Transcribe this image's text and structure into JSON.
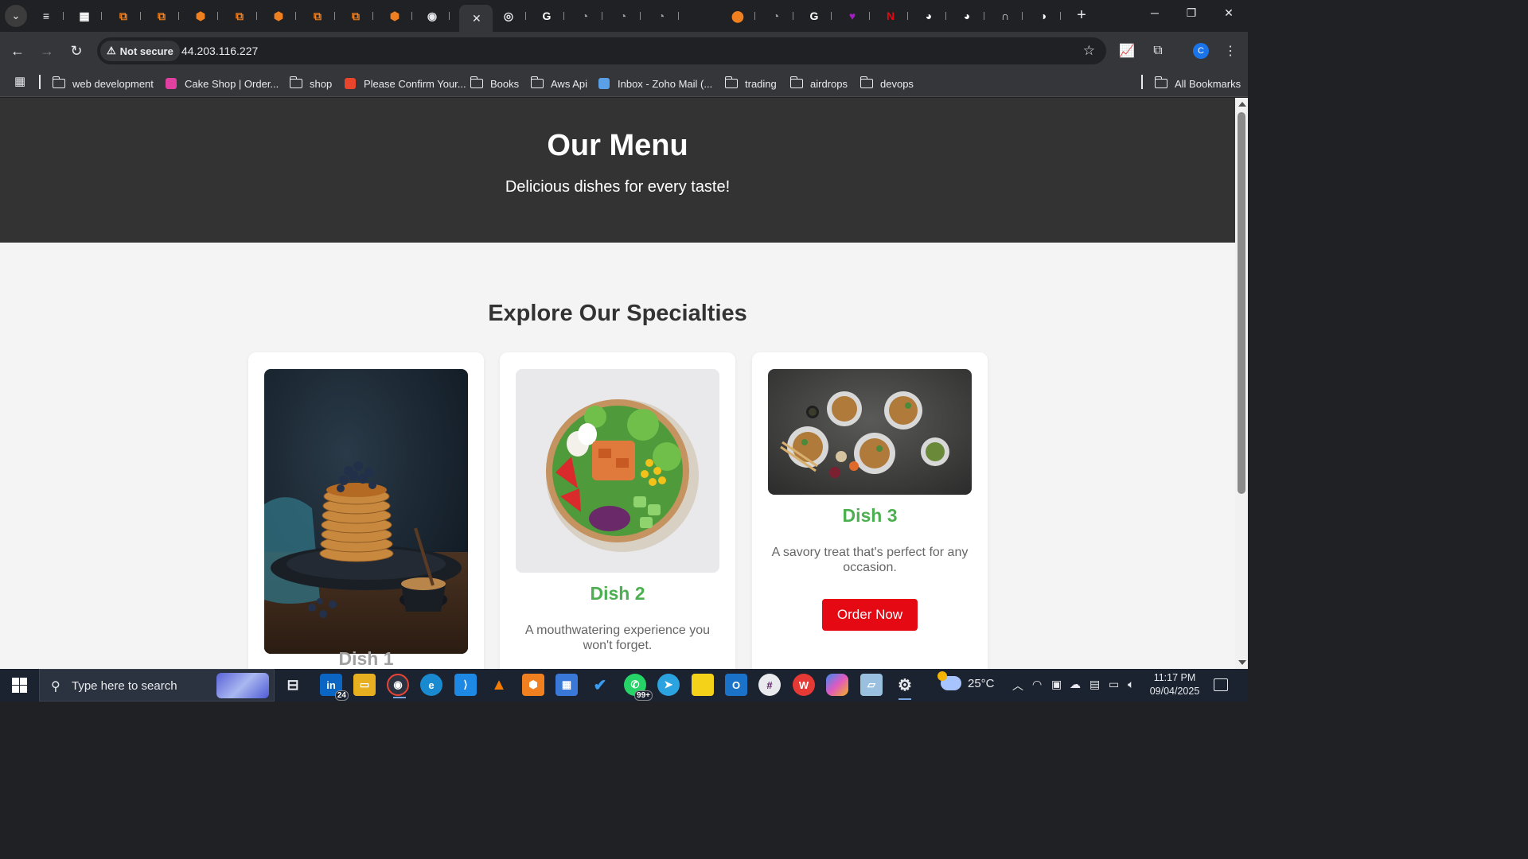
{
  "browser": {
    "tabs": [
      {
        "name": "tab-1",
        "color": "#ffffff",
        "glyph": "≡"
      },
      {
        "name": "tab-2",
        "color": "#ffffff",
        "glyph": "▦"
      },
      {
        "name": "tab-3",
        "color": "#f0801f",
        "glyph": "⧉"
      },
      {
        "name": "tab-4",
        "color": "#f0801f",
        "glyph": "⧉"
      },
      {
        "name": "tab-5",
        "color": "#f0801f",
        "glyph": "⬢"
      },
      {
        "name": "tab-6",
        "color": "#f0801f",
        "glyph": "⧉"
      },
      {
        "name": "tab-7",
        "color": "#f0801f",
        "glyph": "⬢"
      },
      {
        "name": "tab-8",
        "color": "#f0801f",
        "glyph": "⧉"
      },
      {
        "name": "tab-9",
        "color": "#f0801f",
        "glyph": "⧉"
      },
      {
        "name": "tab-10",
        "color": "#f0801f",
        "glyph": "⬢"
      },
      {
        "name": "tab-11",
        "color": "#e8eaed",
        "glyph": "◉"
      },
      {
        "name": "tab-13",
        "color": "#e8eaed",
        "glyph": "◎"
      },
      {
        "name": "tab-14",
        "color": "#ffffff",
        "glyph": "G"
      },
      {
        "name": "tab-15",
        "color": "#9aa0a6",
        "glyph": "◔"
      },
      {
        "name": "tab-16",
        "color": "#9aa0a6",
        "glyph": "◔"
      },
      {
        "name": "tab-17",
        "color": "#9aa0a6",
        "glyph": "◔"
      },
      {
        "name": "tab-18",
        "color": "#f0801f",
        "glyph": "⬤"
      },
      {
        "name": "tab-19",
        "color": "#9aa0a6",
        "glyph": "◔"
      },
      {
        "name": "tab-20",
        "color": "#ffffff",
        "glyph": "G"
      },
      {
        "name": "tab-21",
        "color": "#a020c0",
        "glyph": "♥"
      },
      {
        "name": "tab-22",
        "color": "#e50914",
        "glyph": "N"
      },
      {
        "name": "tab-23",
        "color": "#ffffff",
        "glyph": "◕"
      },
      {
        "name": "tab-24",
        "color": "#ffffff",
        "glyph": "◕"
      },
      {
        "name": "tab-25",
        "color": "#e8eaed",
        "glyph": "∩"
      },
      {
        "name": "tab-26",
        "color": "#ffffff",
        "glyph": "◑"
      }
    ],
    "active_tab_close": "✕",
    "new_tab": "+",
    "window_controls": {
      "minimize": "─",
      "restore": "❐",
      "close": "✕"
    },
    "nav": {
      "back": "←",
      "forward": "→",
      "reload": "↻"
    },
    "security_label": "Not secure",
    "url": "44.203.116.227",
    "profile_initial": "C",
    "bookmarks": [
      {
        "label": "web development",
        "type": "folder"
      },
      {
        "label": "Cake Shop | Order...",
        "type": "site",
        "color": "#e040a0"
      },
      {
        "label": "shop",
        "type": "folder"
      },
      {
        "label": "Please Confirm Your...",
        "type": "site",
        "color": "#e8452c"
      },
      {
        "label": "Books",
        "type": "folder"
      },
      {
        "label": "Aws Api",
        "type": "folder"
      },
      {
        "label": "Inbox - Zoho Mail (...",
        "type": "site",
        "color": "#5aa0e6"
      },
      {
        "label": "trading",
        "type": "folder"
      },
      {
        "label": "airdrops",
        "type": "folder"
      },
      {
        "label": "devops",
        "type": "folder"
      }
    ],
    "all_bookmarks": "All Bookmarks"
  },
  "page": {
    "hero_title": "Our Menu",
    "hero_subtitle": "Delicious dishes for every taste!",
    "section_title": "Explore Our Specialties",
    "dishes": [
      {
        "title": "Dish 1",
        "description": "",
        "image": "pancakes-photo"
      },
      {
        "title": "Dish 2",
        "description": "A mouthwatering experience you won't forget.",
        "image": "salmon-salad-bowl-photo"
      },
      {
        "title": "Dish 3",
        "description": "A savory treat that's perfect for any occasion.",
        "image": "assorted-dishes-photo",
        "button": "Order Now"
      }
    ],
    "colors": {
      "hero_bg": "#333333",
      "dish_title": "#4caf50",
      "order_button": "#e50914",
      "page_bg": "#f4f4f4"
    }
  },
  "taskbar": {
    "search_placeholder": "Type here to search",
    "linkedin_badge": "24",
    "whatsapp_badge": "99+",
    "temperature": "25°C",
    "time": "11:17 PM",
    "date": "09/04/2025"
  }
}
